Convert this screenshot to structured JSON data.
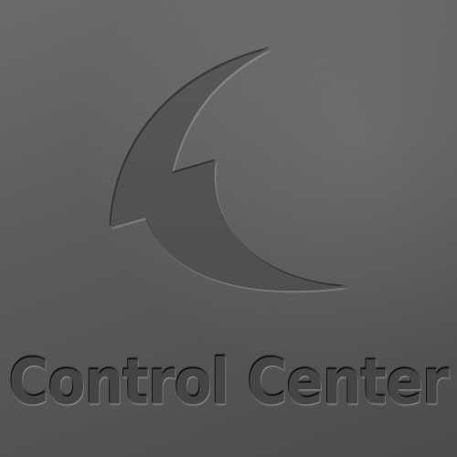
{
  "app": {
    "name": "Control Center",
    "logo_icon": "wave-hook-logo-icon"
  },
  "colors": {
    "background": "#5c5c5c",
    "emboss_fill": "#535353",
    "text": "#454545"
  }
}
